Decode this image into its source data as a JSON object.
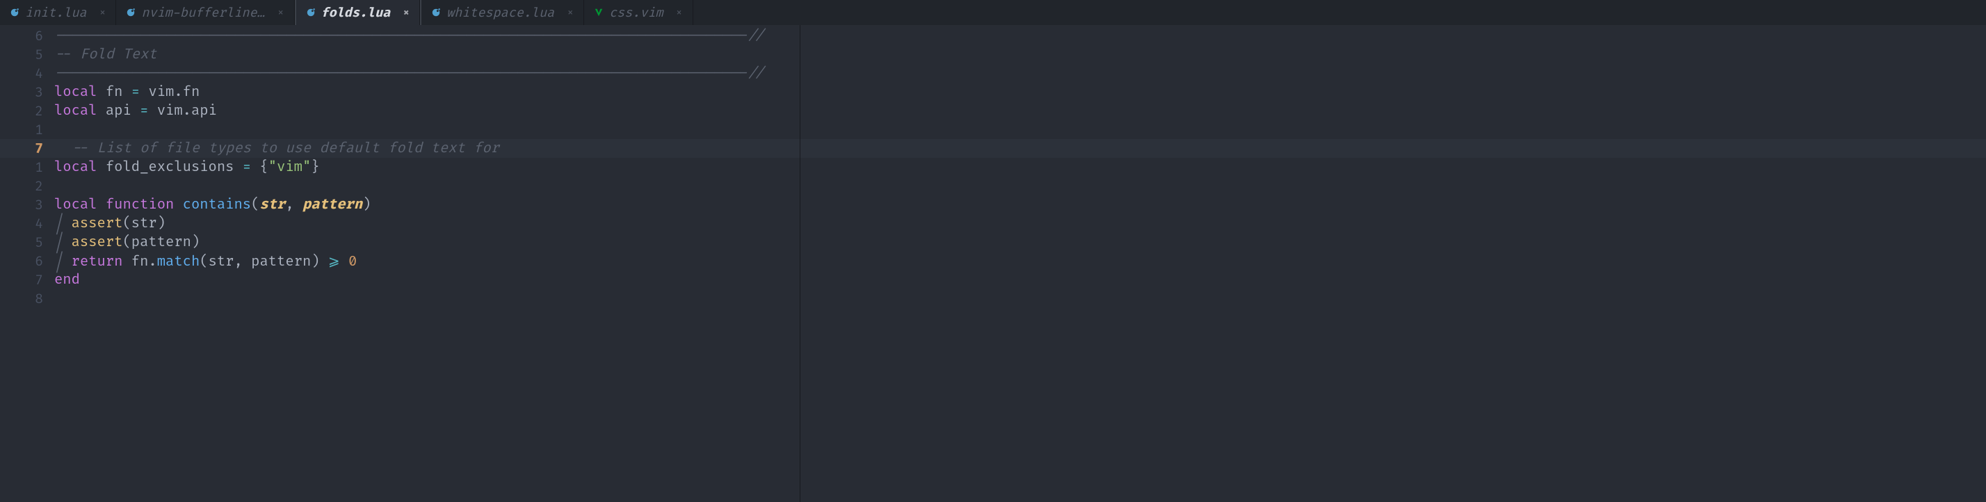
{
  "tabs": [
    {
      "label": "init.lua",
      "icon": "lua",
      "active": false,
      "close": "×"
    },
    {
      "label": "nvim-bufferline…",
      "icon": "lua",
      "active": false,
      "close": "×"
    },
    {
      "label": "folds.lua",
      "icon": "lua",
      "active": true,
      "close": "×"
    },
    {
      "label": "whitespace.lua",
      "icon": "lua",
      "active": false,
      "close": "×"
    },
    {
      "label": "css.vim",
      "icon": "vim",
      "active": false,
      "close": "×"
    }
  ],
  "gutter": [
    "6",
    "5",
    "4",
    "3",
    "2",
    "1",
    "7",
    "1",
    "2",
    "3",
    "4",
    "5",
    "6",
    "7",
    "8"
  ],
  "code": {
    "dashline": "---------------------------------------------------------------------------------//",
    "fold_text_comment": "-- Fold Text",
    "local": "local",
    "fn": "fn",
    "api": "api",
    "eq": " = ",
    "vim": "vim",
    "dot": ".",
    "fn_field": "fn",
    "api_field": "api",
    "list_comment": "-- List of file types to use default fold text for",
    "fold_exclusions": "fold_exclusions",
    "braces_open": "{",
    "braces_close": "}",
    "vim_str": "\"vim\"",
    "function": "function",
    "contains": "contains",
    "paren_open": "(",
    "paren_close": ")",
    "str": "str",
    "comma": ", ",
    "pattern": "pattern",
    "assert": "assert",
    "return": "return",
    "match": "match",
    "gte": " ⩾ ",
    "zero": "0",
    "end": "end",
    "indent_bar": "│ "
  }
}
